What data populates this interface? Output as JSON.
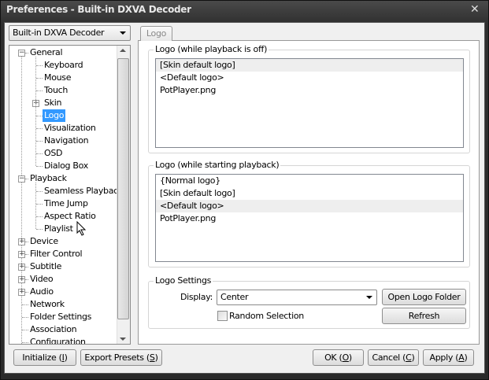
{
  "window": {
    "title": "Preferences - Built-in DXVA Decoder",
    "close": "✕"
  },
  "preset_combo": {
    "value": "Built-in DXVA Decoder"
  },
  "tree": [
    {
      "label": "General",
      "level": 0,
      "expander": "minus"
    },
    {
      "label": "Keyboard",
      "level": 1
    },
    {
      "label": "Mouse",
      "level": 1
    },
    {
      "label": "Touch",
      "level": 1
    },
    {
      "label": "Skin",
      "level": 1,
      "expander": "plus"
    },
    {
      "label": "Logo",
      "level": 1,
      "selected": true
    },
    {
      "label": "Visualization",
      "level": 1
    },
    {
      "label": "Navigation",
      "level": 1
    },
    {
      "label": "OSD",
      "level": 1
    },
    {
      "label": "Dialog Box",
      "level": 1
    },
    {
      "label": "Playback",
      "level": 0,
      "expander": "minus"
    },
    {
      "label": "Seamless Playback",
      "level": 1
    },
    {
      "label": "Time Jump",
      "level": 1
    },
    {
      "label": "Aspect Ratio",
      "level": 1
    },
    {
      "label": "Playlist",
      "level": 1
    },
    {
      "label": "Device",
      "level": 0,
      "expander": "plus"
    },
    {
      "label": "Filter Control",
      "level": 0,
      "expander": "plus"
    },
    {
      "label": "Subtitle",
      "level": 0,
      "expander": "plus"
    },
    {
      "label": "Video",
      "level": 0,
      "expander": "plus"
    },
    {
      "label": "Audio",
      "level": 0,
      "expander": "plus"
    },
    {
      "label": "Network",
      "level": 0
    },
    {
      "label": "Folder Settings",
      "level": 0
    },
    {
      "label": "Association",
      "level": 0
    },
    {
      "label": "Configuration",
      "level": 0
    }
  ],
  "tab": {
    "label": "Logo"
  },
  "group_off": {
    "label": "Logo (while playback is off)",
    "items": [
      "[Skin default logo]",
      "<Default logo>",
      "PotPlayer.png"
    ],
    "highlighted": 0
  },
  "group_start": {
    "label": "Logo (while starting playback)",
    "items": [
      "{Normal logo}",
      "[Skin default logo]",
      "<Default logo>",
      "PotPlayer.png"
    ],
    "highlighted": 2
  },
  "settings": {
    "label": "Logo Settings",
    "display_label": "Display:",
    "display_value": "Center",
    "open_folder": "Open Logo Folder",
    "refresh": "Refresh",
    "random_label": "Random Selection",
    "random_checked": false
  },
  "buttons": {
    "initialize": "Initialize",
    "initialize_key": "I",
    "export": "Export Presets",
    "export_key": "S",
    "ok": "OK",
    "ok_key": "O",
    "cancel": "Cancel",
    "cancel_key": "C",
    "apply": "Apply",
    "apply_key": "A"
  }
}
